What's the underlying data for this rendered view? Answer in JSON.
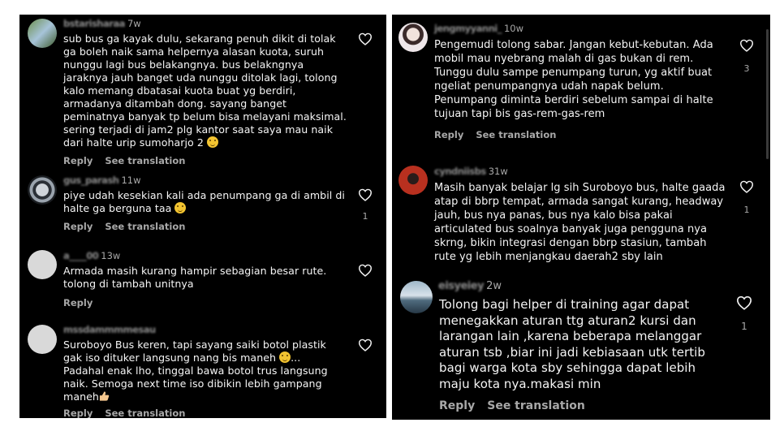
{
  "colors": {
    "background": "#000000",
    "text": "#f5f5f5",
    "muted": "#a8a8a8",
    "avatar_placeholder": "#d9d9d9"
  },
  "left": {
    "comments": [
      {
        "username": "bstarisharaa",
        "time": "7w",
        "text": "sub bus ga kayak dulu, sekarang penuh dikit di tolak\nga boleh naik sama helpernya alasan kuota, suruh\nnunggu lagi bus belakangnya. bus belakngnya\njaraknya jauh banget uda nunggu ditolak lagi,  tolong\nkalo memang dbatasai kuota buat yg berdiri,\narmadanya ditambah dong. sayang banget\npeminatnya banyak tp belum bisa melayani maksimal.\nsering terjadi di jam2 plg kantor saat saya mau naik\ndari halte urip sumoharjo 2",
        "emoji": "sad-face-emoji",
        "reply": "Reply",
        "see_translation": "See translation",
        "likes": ""
      },
      {
        "username": "gus_parash",
        "time": "11w",
        "text": "piye udah kesekian kali ada penumpang ga di ambil di\nhalte ga berguna taa",
        "emoji": "laughing-face-emoji",
        "reply": "Reply",
        "see_translation": "See translation",
        "likes": "1"
      },
      {
        "username": "a____00",
        "time": "13w",
        "text": "Armada masih kurang hampir sebagian besar rute.\ntolong di tambah unitnya",
        "reply": "Reply",
        "likes": ""
      },
      {
        "username": "mssdammmmesau",
        "time": "",
        "text": "Suroboyo Bus keren, tapi sayang saiki botol plastik\ngak iso dituker langsung nang bis maneh",
        "text2": "Padahal enak lho, tinggal bawa botol trus langsung\nnaik. Semoga next time iso dibikin lebih gampang\nmaneh",
        "ellipsis": "...",
        "emoji": "sweat-face-emoji",
        "reply": "Reply",
        "see_translation": "See translation",
        "likes": ""
      }
    ]
  },
  "right": {
    "comments": [
      {
        "username": "jengmyyanni_",
        "time": "10w",
        "text": "Pengemudi tolong sabar. Jangan kebut-kebutan. Ada\nmobil mau nyebrang malah di gas bukan di rem.\nTunggu dulu sampe penumpang turun, yg aktif buat\nngeliat penumpangnya udah napak belum.\nPenumpang diminta berdiri sebelum sampai di halte\ntujuan tapi bis gas-rem-gas-rem",
        "reply": "Reply",
        "see_translation": "See translation",
        "likes": "3"
      },
      {
        "username": "cyndniisbs",
        "time": "31w",
        "text": "Masih banyak belajar lg sih Suroboyo bus, halte gaada\natap di bbrp tempat, armada sangat kurang, headway\njauh, bus nya panas, bus nya kalo bisa pakai\narticulated bus soalnya banyak juga pengguna nya\nskrng, bikin integrasi dengan bbrp stasiun, tambah\nrute yg lebih menjangkau daerah2 sby lain",
        "likes": "1"
      },
      {
        "username": "eisyeiey",
        "time": "2w",
        "text": "Tolong bagi helper di training agar dapat\nmenegakkan aturan ttg aturan2 kursi dan\nlarangan lain ,karena beberapa melanggar\naturan tsb ,biar ini jadi kebiasaan utk tertib\nbagi warga kota sby sehingga dapat lebih\nmaju kota nya.makasi min",
        "reply": "Reply",
        "see_translation": "See translation",
        "likes": "1"
      }
    ]
  }
}
